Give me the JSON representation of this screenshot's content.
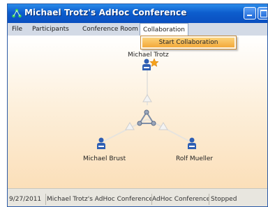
{
  "window": {
    "title": "Michael Trotz's AdHoc Conference"
  },
  "menu": {
    "items": [
      "File",
      "Participants",
      "Conference Room",
      "Collaboration"
    ],
    "active": "Collaboration",
    "dropdown": [
      "Start Collaboration"
    ]
  },
  "participants": {
    "host": "Michael Trotz",
    "left": "Michael Brust",
    "right": "Rolf Mueller"
  },
  "status": {
    "date": "9/27/2011",
    "conference": "Michael Trotz's AdHoc Conference",
    "type": "AdHoc Conference",
    "state": "Stopped"
  },
  "icons": {
    "app": "network-icon",
    "host_badge": "star-icon",
    "user": "user-icon",
    "hub": "conference-hub-icon",
    "link_marker": "triangle-marker-icon"
  },
  "colors": {
    "titlebar": "#0d5dcd",
    "menubar": "#d3dae6",
    "highlight": "#f3a93a",
    "canvas_bottom": "#fbdfb9",
    "user_blue": "#2f5fb3",
    "star": "#f7a21b"
  }
}
